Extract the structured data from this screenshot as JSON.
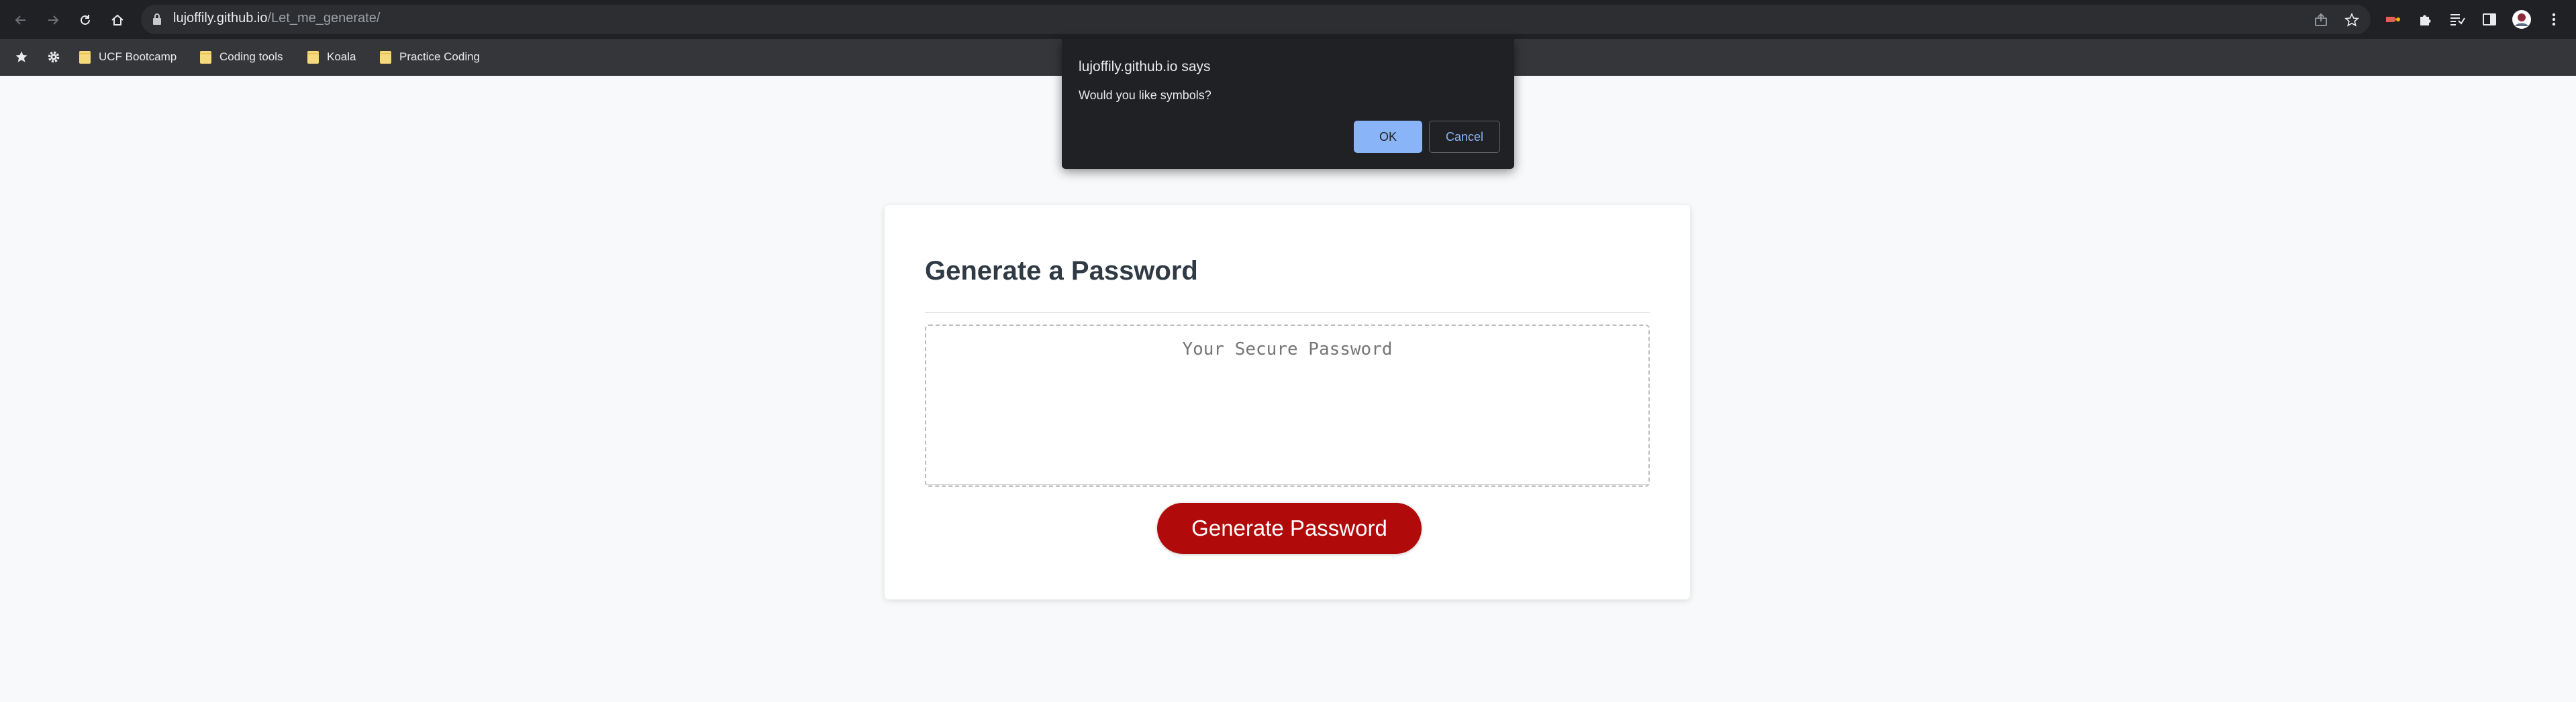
{
  "browser": {
    "url_host": "lujoffily.github.io",
    "url_path": "/Let_me_generate/",
    "bookmarks": [
      {
        "label": "UCF Bootcamp"
      },
      {
        "label": "Coding tools"
      },
      {
        "label": "Koala"
      },
      {
        "label": "Practice Coding"
      }
    ]
  },
  "dialog": {
    "title": "lujoffily.github.io says",
    "message": "Would you like symbols?",
    "ok_label": "OK",
    "cancel_label": "Cancel"
  },
  "page": {
    "heading": "Generate a Password",
    "password_placeholder": "Your Secure Password",
    "generate_label": "Generate Password"
  },
  "colors": {
    "accent_button": "#b00a0a",
    "dialog_ok": "#8ab4f8",
    "chrome_bg": "#202124"
  },
  "icons": [
    "back-icon",
    "forward-icon",
    "reload-icon",
    "home-icon",
    "lock-icon",
    "share-icon",
    "star-icon",
    "extension-record-icon",
    "puzzle-icon",
    "reading-list-icon",
    "side-panel-icon",
    "profile-avatar-icon",
    "menu-dots-icon",
    "bookmark-star-icon",
    "settings-gear-icon",
    "folder-icon"
  ]
}
